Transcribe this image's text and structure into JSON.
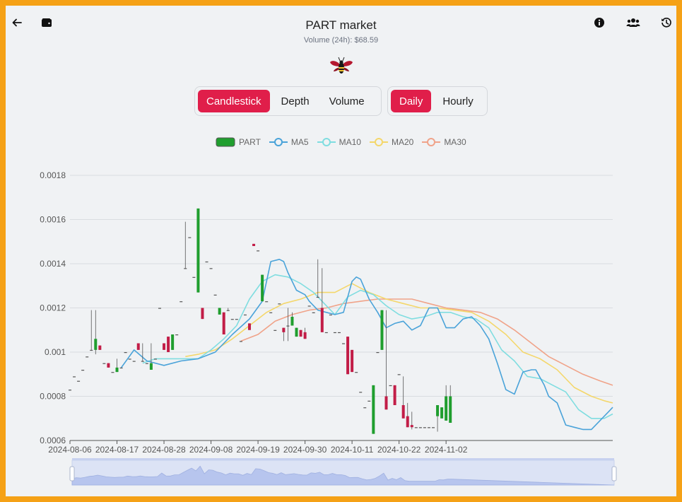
{
  "header": {
    "title": "PART market",
    "volume_text": "Volume (24h): $68.59"
  },
  "tabs": {
    "chart_types": [
      "Candlestick",
      "Depth",
      "Volume"
    ],
    "active_chart_type": "Candlestick",
    "intervals": [
      "Daily",
      "Hourly"
    ],
    "active_interval": "Daily"
  },
  "icons": {
    "back": "arrow-left-icon",
    "wallet": "wallet-icon",
    "info": "info-icon",
    "users": "users-icon",
    "history": "history-icon",
    "logo": "bee-logo-icon"
  },
  "colors": {
    "accent": "#e01e4a",
    "up": "#1f9e2e",
    "down": "#c21d47",
    "ma5": "#4aa3d9",
    "ma10": "#7fdde0",
    "ma20": "#f4d76b",
    "ma30": "#f0a389",
    "frame": "#f5a116"
  },
  "chart_data": {
    "type": "candlestick",
    "legend": [
      "PART",
      "MA5",
      "MA10",
      "MA20",
      "MA30"
    ],
    "y_ticks": [
      "0.0006",
      "0.0008",
      "0.001",
      "0.0012",
      "0.0014",
      "0.0016",
      "0.0018"
    ],
    "ylim": [
      0.0006,
      0.0018
    ],
    "x_ticks": [
      "2024-08-06",
      "2024-08-17",
      "2024-08-28",
      "2024-09-08",
      "2024-09-19",
      "2024-09-30",
      "2024-10-11",
      "2024-10-22",
      "2024-11-02"
    ],
    "start_date": "2024-08-06",
    "candles": [
      [
        0.00083,
        0.00083,
        0.00083,
        0.00083
      ],
      [
        0.00089,
        0.00089,
        0.00089,
        0.00089
      ],
      [
        0.00087,
        0.00087,
        0.00087,
        0.00087
      ],
      [
        0.00092,
        0.00092,
        0.00092,
        0.00092
      ],
      [
        0.00098,
        0.00098,
        0.00098,
        0.00098
      ],
      [
        0.00101,
        0.00101,
        0.00119,
        0.00101
      ],
      [
        0.00101,
        0.00106,
        0.00119,
        0.00099
      ],
      [
        0.00103,
        0.00101,
        0.00103,
        0.00101
      ],
      [
        0.00095,
        0.00095,
        0.00095,
        0.00095
      ],
      [
        0.00095,
        0.00093,
        0.00095,
        0.00093
      ],
      [
        0.00091,
        0.00091,
        0.00091,
        0.00091
      ],
      [
        0.00091,
        0.00093,
        0.00097,
        0.00091
      ],
      [
        0.00093,
        0.00093,
        0.00093,
        0.00093
      ],
      [
        0.001,
        0.001,
        0.001,
        0.001
      ],
      [
        0.00097,
        0.00097,
        0.00097,
        0.00097
      ],
      [
        0.00096,
        0.00096,
        0.00096,
        0.00096
      ],
      [
        0.00104,
        0.00101,
        0.00104,
        0.00101
      ],
      [
        0.00096,
        0.00096,
        0.00104,
        0.00096
      ],
      [
        0.00095,
        0.00095,
        0.00095,
        0.00095
      ],
      [
        0.00092,
        0.00095,
        0.00104,
        0.00092
      ],
      [
        0.00097,
        0.00097,
        0.00097,
        0.00097
      ],
      [
        0.0012,
        0.0012,
        0.0012,
        0.0012
      ],
      [
        0.00104,
        0.00101,
        0.00104,
        0.00101
      ],
      [
        0.00107,
        0.001,
        0.00107,
        0.001
      ],
      [
        0.00101,
        0.00108,
        0.00108,
        0.00101
      ],
      [
        0.00108,
        0.00108,
        0.00108,
        0.00108
      ],
      [
        0.00123,
        0.00123,
        0.00123,
        0.00123
      ],
      [
        0.00138,
        0.00138,
        0.00159,
        0.00138
      ],
      [
        0.00152,
        0.00152,
        0.00152,
        0.00152
      ],
      [
        0.00134,
        0.00134,
        0.00134,
        0.00134
      ],
      [
        0.00127,
        0.00165,
        0.00165,
        0.00127
      ],
      [
        0.0012,
        0.00115,
        0.0012,
        0.00115
      ],
      [
        0.00141,
        0.00141,
        0.00141,
        0.00141
      ],
      [
        0.00138,
        0.00138,
        0.00138,
        0.00138
      ],
      [
        0.00126,
        0.00126,
        0.00126,
        0.00126
      ],
      [
        0.00117,
        0.0012,
        0.0012,
        0.00117
      ],
      [
        0.00118,
        0.00108,
        0.00118,
        0.00108
      ],
      [
        0.00119,
        0.00119,
        0.0012,
        0.00119
      ],
      [
        0.00115,
        0.00115,
        0.00115,
        0.00115
      ],
      [
        0.00115,
        0.00115,
        0.00115,
        0.00115
      ],
      [
        0.00105,
        0.00105,
        0.00105,
        0.00105
      ],
      [
        0.00117,
        0.00117,
        0.00117,
        0.00117
      ],
      [
        0.00113,
        0.0011,
        0.00113,
        0.0011
      ],
      [
        0.00149,
        0.00148,
        0.00149,
        0.00148
      ],
      [
        0.00146,
        0.00146,
        0.00146,
        0.00146
      ],
      [
        0.00123,
        0.00135,
        0.00135,
        0.00123
      ],
      [
        0.00123,
        0.00123,
        0.00123,
        0.00123
      ],
      [
        0.00118,
        0.00118,
        0.00118,
        0.00118
      ],
      [
        0.0011,
        0.0011,
        0.0011,
        0.0011
      ],
      [
        0.00122,
        0.00122,
        0.00122,
        0.00122
      ],
      [
        0.00111,
        0.00109,
        0.00111,
        0.00105
      ],
      [
        0.00112,
        0.00112,
        0.0012,
        0.00105
      ],
      [
        0.00112,
        0.00116,
        0.00118,
        0.00112
      ],
      [
        0.00107,
        0.00111,
        0.00111,
        0.00107
      ],
      [
        0.0011,
        0.00107,
        0.0011,
        0.00107
      ],
      [
        0.00109,
        0.00106,
        0.00111,
        0.00106
      ],
      [
        0.00121,
        0.00121,
        0.00121,
        0.00121
      ],
      [
        0.00118,
        0.00118,
        0.00118,
        0.00118
      ],
      [
        0.00125,
        0.00125,
        0.00142,
        0.00125
      ],
      [
        0.0012,
        0.00109,
        0.00138,
        0.00109
      ],
      [
        0.00109,
        0.00109,
        0.00109,
        0.00109
      ],
      [
        0.00117,
        0.00117,
        0.00117,
        0.00117
      ],
      [
        0.00109,
        0.00109,
        0.00109,
        0.00109
      ],
      [
        0.00109,
        0.00109,
        0.00109,
        0.00109
      ],
      [
        0.00104,
        0.00104,
        0.00104,
        0.00104
      ],
      [
        0.00107,
        0.0009,
        0.00107,
        0.0009
      ],
      [
        0.00101,
        0.00091,
        0.00101,
        0.00091
      ],
      [
        0.00091,
        0.00091,
        0.00091,
        0.00091
      ],
      [
        0.00082,
        0.00082,
        0.00082,
        0.00082
      ],
      [
        0.00075,
        0.00075,
        0.00075,
        0.00075
      ],
      [
        0.00078,
        0.00078,
        0.00078,
        0.00078
      ],
      [
        0.00063,
        0.00085,
        0.00085,
        0.00063
      ],
      [
        0.001,
        0.001,
        0.001,
        0.001
      ],
      [
        0.00101,
        0.00119,
        0.00119,
        0.00101
      ],
      [
        0.0008,
        0.00074,
        0.00119,
        0.00074
      ],
      [
        0.00085,
        0.00085,
        0.00085,
        0.00085
      ],
      [
        0.00085,
        0.00076,
        0.00085,
        0.00076
      ],
      [
        0.0009,
        0.0009,
        0.0009,
        0.0009
      ],
      [
        0.00076,
        0.0007,
        0.00089,
        0.0007
      ],
      [
        0.00071,
        0.00066,
        0.00077,
        0.00066
      ],
      [
        0.00067,
        0.00066,
        0.00073,
        0.00065
      ],
      [
        0.00066,
        0.00066,
        0.00066,
        0.00066
      ],
      [
        0.00066,
        0.00066,
        0.00066,
        0.00066
      ],
      [
        0.00066,
        0.00066,
        0.00066,
        0.00066
      ],
      [
        0.00066,
        0.00066,
        0.00066,
        0.00066
      ],
      [
        0.00066,
        0.00066,
        0.00066,
        0.00066
      ],
      [
        0.00071,
        0.00076,
        0.00076,
        0.00064
      ],
      [
        0.0007,
        0.00075,
        0.00075,
        0.0007
      ],
      [
        0.00069,
        0.0008,
        0.00085,
        0.00069
      ],
      [
        0.00068,
        0.0008,
        0.00085,
        0.00068
      ]
    ],
    "ma5": [
      [
        12,
        0.00093
      ],
      [
        15,
        0.00101
      ],
      [
        18,
        0.00096
      ],
      [
        22,
        0.00094
      ],
      [
        26,
        0.00096
      ],
      [
        30,
        0.00097
      ],
      [
        34,
        0.001
      ],
      [
        38,
        0.00108
      ],
      [
        42,
        0.00115
      ],
      [
        45,
        0.00123
      ],
      [
        47,
        0.00141
      ],
      [
        49,
        0.00142
      ],
      [
        50,
        0.00141
      ],
      [
        51,
        0.00136
      ],
      [
        53,
        0.00128
      ],
      [
        55,
        0.00126
      ],
      [
        56,
        0.00123
      ],
      [
        58,
        0.00119
      ],
      [
        60,
        0.00118
      ],
      [
        62,
        0.00117
      ],
      [
        64,
        0.00118
      ],
      [
        66,
        0.00132
      ],
      [
        67,
        0.00134
      ],
      [
        68,
        0.00133
      ],
      [
        70,
        0.00124
      ],
      [
        72,
        0.00118
      ],
      [
        74,
        0.00111
      ],
      [
        76,
        0.00113
      ],
      [
        78,
        0.00114
      ],
      [
        80,
        0.0011
      ],
      [
        82,
        0.00112
      ],
      [
        84,
        0.0012
      ],
      [
        86,
        0.0012
      ],
      [
        88,
        0.00111
      ],
      [
        90,
        0.00111
      ],
      [
        92,
        0.00115
      ],
      [
        94,
        0.00116
      ],
      [
        96,
        0.00112
      ],
      [
        98,
        0.00106
      ],
      [
        100,
        0.00095
      ],
      [
        102,
        0.00083
      ],
      [
        104,
        0.00081
      ],
      [
        106,
        0.00091
      ],
      [
        108,
        0.00092
      ],
      [
        109,
        0.00092
      ],
      [
        111,
        0.00085
      ],
      [
        112,
        0.0008
      ],
      [
        114,
        0.00077
      ],
      [
        116,
        0.00067
      ],
      [
        118,
        0.00066
      ],
      [
        120,
        0.00065
      ],
      [
        122,
        0.00065
      ],
      [
        124,
        0.00069
      ],
      [
        126,
        0.00073
      ],
      [
        127,
        0.00075
      ]
    ],
    "ma10": [
      [
        17,
        0.00095
      ],
      [
        20,
        0.00097
      ],
      [
        24,
        0.00097
      ],
      [
        28,
        0.00097
      ],
      [
        30,
        0.00097
      ],
      [
        33,
        0.00101
      ],
      [
        36,
        0.00106
      ],
      [
        39,
        0.00112
      ],
      [
        42,
        0.00124
      ],
      [
        45,
        0.00132
      ],
      [
        48,
        0.00135
      ],
      [
        51,
        0.00134
      ],
      [
        54,
        0.00131
      ],
      [
        57,
        0.00127
      ],
      [
        60,
        0.00121
      ],
      [
        62,
        0.00117
      ],
      [
        65,
        0.00125
      ],
      [
        68,
        0.00128
      ],
      [
        71,
        0.00126
      ],
      [
        74,
        0.00121
      ],
      [
        77,
        0.00117
      ],
      [
        80,
        0.00115
      ],
      [
        83,
        0.00116
      ],
      [
        86,
        0.00118
      ],
      [
        89,
        0.00118
      ],
      [
        92,
        0.00116
      ],
      [
        95,
        0.00115
      ],
      [
        98,
        0.00111
      ],
      [
        101,
        0.00101
      ],
      [
        104,
        0.00096
      ],
      [
        107,
        0.00089
      ],
      [
        110,
        0.00088
      ],
      [
        113,
        0.00085
      ],
      [
        116,
        0.00082
      ],
      [
        119,
        0.00074
      ],
      [
        122,
        0.0007
      ],
      [
        125,
        0.0007
      ],
      [
        127,
        0.00072
      ]
    ],
    "ma20": [
      [
        27,
        0.00098
      ],
      [
        30,
        0.00099
      ],
      [
        34,
        0.00101
      ],
      [
        38,
        0.00106
      ],
      [
        42,
        0.00112
      ],
      [
        46,
        0.00118
      ],
      [
        50,
        0.00122
      ],
      [
        54,
        0.00124
      ],
      [
        58,
        0.00127
      ],
      [
        62,
        0.00127
      ],
      [
        66,
        0.00131
      ],
      [
        70,
        0.00127
      ],
      [
        74,
        0.00124
      ],
      [
        78,
        0.00122
      ],
      [
        82,
        0.0012
      ],
      [
        86,
        0.0012
      ],
      [
        90,
        0.00119
      ],
      [
        94,
        0.00118
      ],
      [
        98,
        0.00114
      ],
      [
        102,
        0.00108
      ],
      [
        106,
        0.001
      ],
      [
        110,
        0.00097
      ],
      [
        114,
        0.00092
      ],
      [
        118,
        0.00084
      ],
      [
        122,
        0.0008
      ],
      [
        125,
        0.00078
      ],
      [
        127,
        0.00077
      ]
    ],
    "ma30": [
      [
        40,
        0.00105
      ],
      [
        44,
        0.00108
      ],
      [
        48,
        0.00114
      ],
      [
        52,
        0.00117
      ],
      [
        56,
        0.00119
      ],
      [
        60,
        0.0012
      ],
      [
        64,
        0.00122
      ],
      [
        68,
        0.00123
      ],
      [
        72,
        0.00124
      ],
      [
        76,
        0.00124
      ],
      [
        80,
        0.00124
      ],
      [
        84,
        0.00122
      ],
      [
        88,
        0.0012
      ],
      [
        92,
        0.00119
      ],
      [
        96,
        0.00118
      ],
      [
        100,
        0.00115
      ],
      [
        104,
        0.0011
      ],
      [
        108,
        0.00104
      ],
      [
        112,
        0.00098
      ],
      [
        116,
        0.00094
      ],
      [
        120,
        0.0009
      ],
      [
        124,
        0.00087
      ],
      [
        127,
        0.00085
      ]
    ]
  }
}
